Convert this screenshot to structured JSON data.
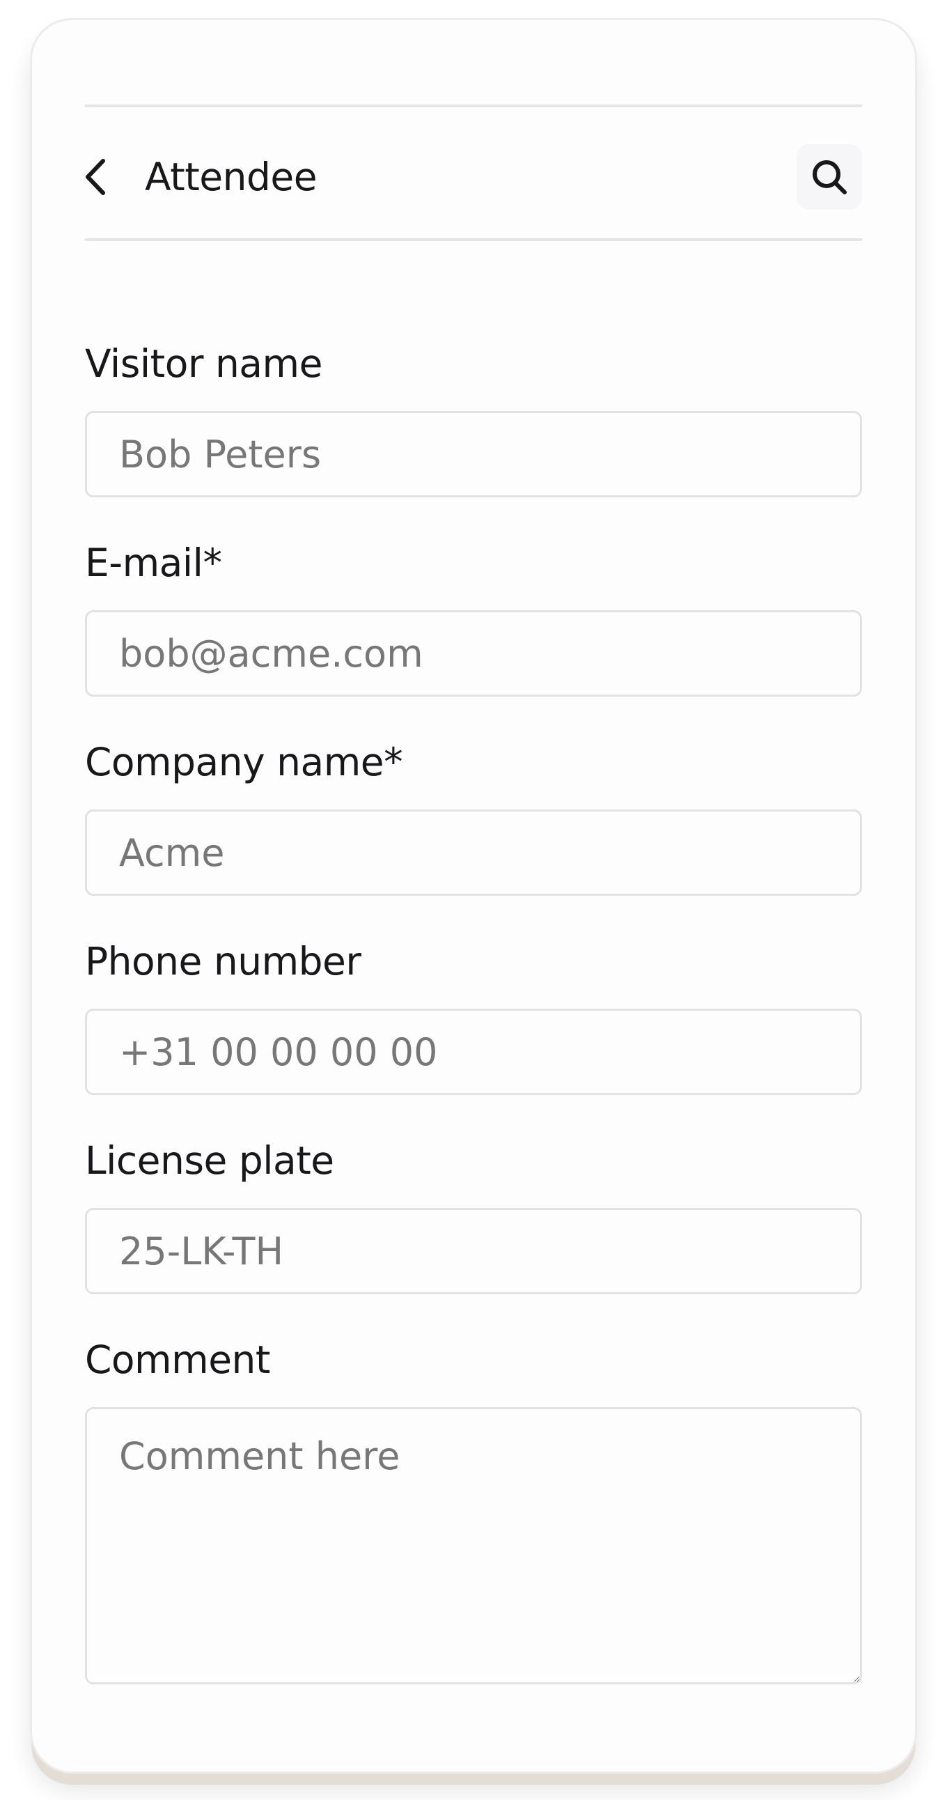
{
  "header": {
    "title": "Attendee",
    "back_icon": "chevron-left-icon",
    "search_icon": "search-icon"
  },
  "form": {
    "visitor_name": {
      "label": "Visitor name",
      "placeholder": "Bob Peters",
      "value": ""
    },
    "email": {
      "label": "E-mail*",
      "placeholder": "bob@acme.com",
      "value": ""
    },
    "company_name": {
      "label": "Company name*",
      "placeholder": "Acme",
      "value": ""
    },
    "phone_number": {
      "label": "Phone number",
      "placeholder": "+31 00 00 00 00",
      "value": ""
    },
    "license_plate": {
      "label": "License plate",
      "placeholder": "25-LK-TH",
      "value": ""
    },
    "comment": {
      "label": "Comment",
      "placeholder": "Comment here",
      "value": ""
    }
  },
  "colors": {
    "text": "#18181b",
    "placeholder": "#777777",
    "border": "#e2e2e2",
    "search_button_bg": "#f6f5f7"
  }
}
